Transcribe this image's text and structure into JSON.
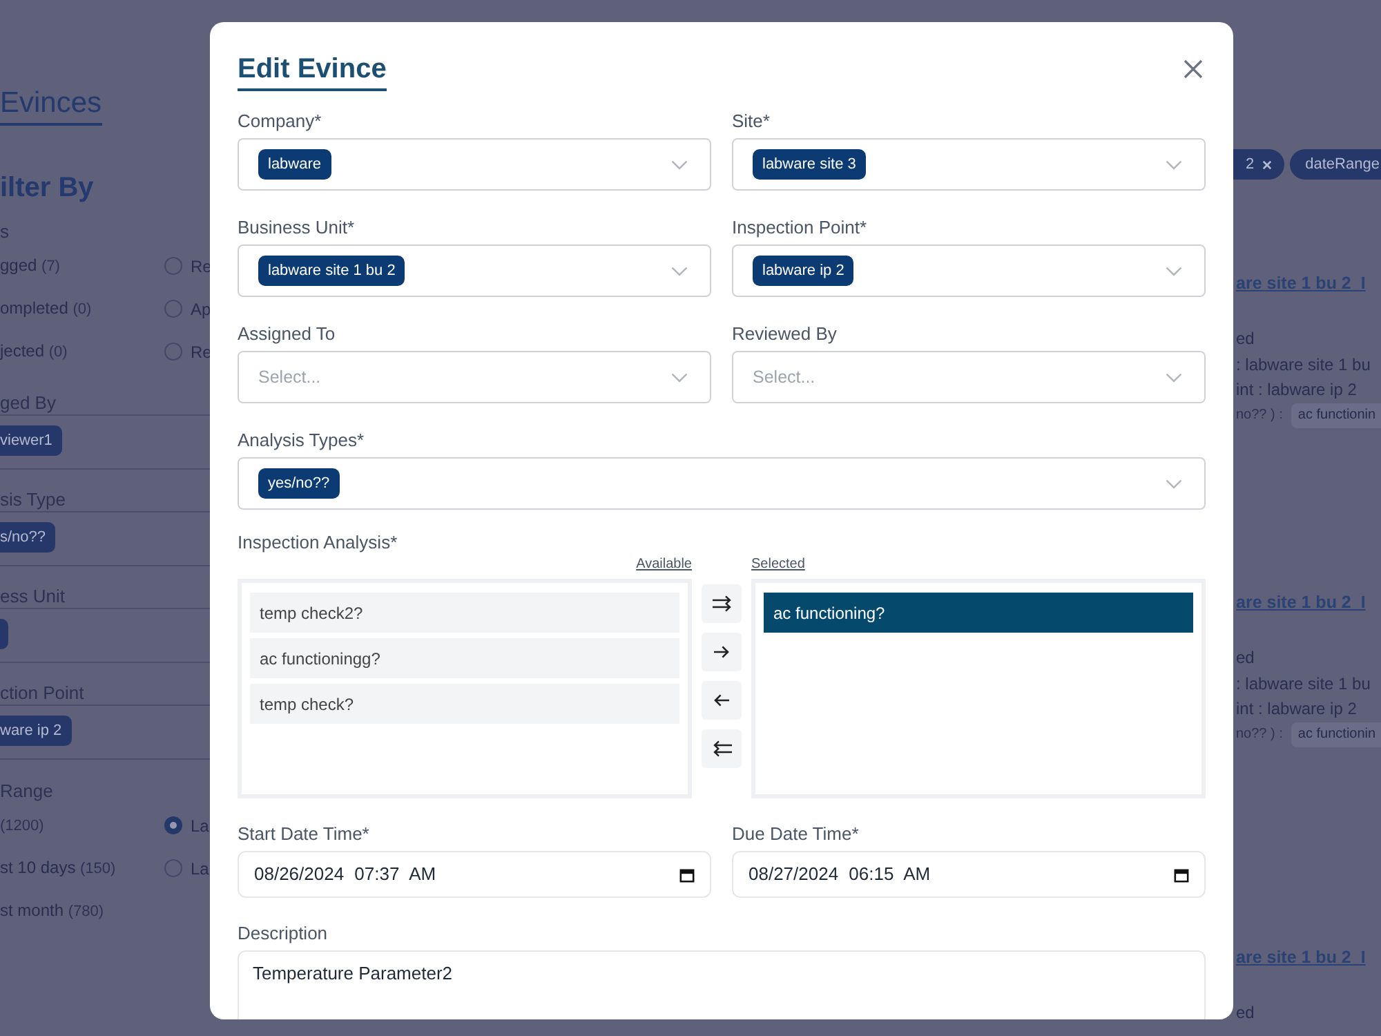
{
  "page": {
    "title": "Evinces",
    "filter_title": "ilter By",
    "status": {
      "heading": "s",
      "options": [
        {
          "label": "gged",
          "count": "(7)"
        },
        {
          "label": "ompleted",
          "count": "(0)"
        },
        {
          "label": "jected",
          "count": "(0)"
        }
      ],
      "radios": [
        {
          "label": "Re",
          "selected": false
        },
        {
          "label": "Ap",
          "selected": false
        },
        {
          "label": "Re",
          "selected": false
        }
      ]
    },
    "filters": [
      {
        "heading": "ged By",
        "tag": "viewer1"
      },
      {
        "heading": "sis Type",
        "tag": "s/no??"
      },
      {
        "heading": "ess Unit",
        "tag_cut": true
      },
      {
        "heading": "ction Point",
        "tag": "ware ip 2"
      }
    ],
    "date_range": {
      "heading": "Range",
      "options": [
        {
          "count": "(1200)"
        },
        {
          "label": "st 10 days",
          "count": "(150)"
        },
        {
          "label": "st month",
          "count": "(780)"
        }
      ],
      "radios": [
        {
          "label": "La",
          "selected": true
        },
        {
          "label": "La",
          "selected": false
        }
      ]
    },
    "applied_filters": [
      {
        "label": "2",
        "removable": true
      },
      {
        "label": "dateRange"
      }
    ],
    "cards": [
      {
        "title": "are site 1 bu 2_I",
        "status": "ed",
        "business_unit": ": labware site 1 bu",
        "inspection_point": "int : labware ip 2",
        "analysis_label": "no?? ) :",
        "analysis_tag": "ac functionin"
      },
      {
        "title": "are site 1 bu 2_I",
        "status": "ed",
        "business_unit": ": labware site 1 bu",
        "inspection_point": "int : labware ip 2",
        "analysis_label": "no?? ) :",
        "analysis_tag": "ac functionin"
      },
      {
        "title": "are site 1 bu 2_I",
        "status": "ed"
      }
    ]
  },
  "modal": {
    "title": "Edit Evince",
    "fields": [
      {
        "label": "Company*",
        "tags": [
          "labware"
        ]
      },
      {
        "label": "Site*",
        "tags": [
          "labware site 3"
        ]
      },
      {
        "label": "Business Unit*",
        "tags": [
          "labware site 1 bu 2"
        ]
      },
      {
        "label": "Inspection Point*",
        "tags": [
          "labware ip 2"
        ]
      },
      {
        "label": "Assigned To",
        "placeholder": "Select..."
      },
      {
        "label": "Reviewed By",
        "placeholder": "Select..."
      }
    ],
    "analysis_types": {
      "label": "Analysis Types*",
      "tags": [
        "yes/no??"
      ]
    },
    "inspection_analysis": {
      "label": "Inspection Analysis*",
      "available_heading": "Available",
      "selected_heading": "Selected",
      "available": [
        {
          "label": "temp check2?",
          "selected": false
        },
        {
          "label": "ac functioningg?",
          "selected": false
        },
        {
          "label": "temp check?",
          "selected": false
        }
      ],
      "selected": [
        {
          "label": "ac functioning?",
          "selected": true
        }
      ]
    },
    "dates": [
      {
        "label": "Start Date Time*",
        "value": "08/26/2024 07:37 AM"
      },
      {
        "label": "Due Date Time*",
        "value": "08/27/2024 06:15 AM"
      }
    ],
    "description": {
      "label": "Description",
      "value": "Temperature Parameter2"
    }
  }
}
